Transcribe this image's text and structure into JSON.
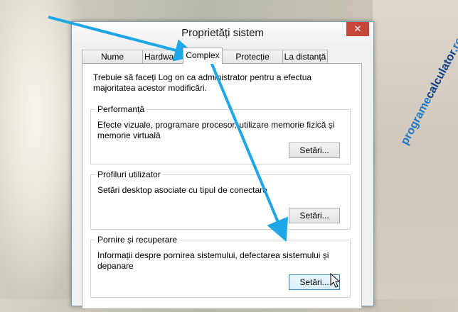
{
  "watermark": {
    "part1": "programe",
    "part2": "calculator",
    "part3": ".ro"
  },
  "dialog": {
    "title": "Proprietăți sistem",
    "close_glyph": "✕",
    "tabs": [
      {
        "label": "Nume computer"
      },
      {
        "label": "Hardware"
      },
      {
        "label": "Complex",
        "active": true
      },
      {
        "label": "Protecție sistem"
      },
      {
        "label": "La distanță"
      }
    ],
    "info_text": "Trebuie să faceți Log on ca administrator pentru a efectua majoritatea acestor modificări.",
    "groups": [
      {
        "title": "Performanță",
        "description": "Efecte vizuale, programare procesor, utilizare memorie fizică și memorie virtuală",
        "button": "Setări..."
      },
      {
        "title": "Profiluri utilizator",
        "description": "Setări desktop asociate cu tipul de conectare",
        "button": "Setări..."
      },
      {
        "title": "Pornire și recuperare",
        "description": "Informații despre pornirea sistemului, defectarea sistemului și depanare",
        "button": "Setări..."
      }
    ]
  },
  "colors": {
    "arrow": "#1ea6e6",
    "close_button": "#c7463a",
    "accent": "#3c7fb1"
  },
  "icons": {
    "close": "close-icon",
    "cursor": "mouse-pointer-icon"
  }
}
